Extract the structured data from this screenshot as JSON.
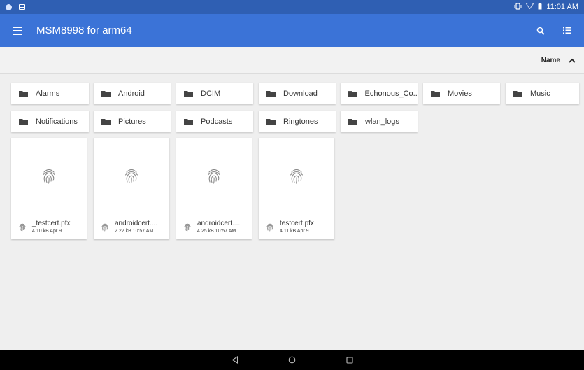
{
  "status_bar": {
    "time": "11:01 AM"
  },
  "app_bar": {
    "title": "MSM8998 for arm64"
  },
  "sort": {
    "label": "Name"
  },
  "folders": [
    {
      "name": "Alarms"
    },
    {
      "name": "Android"
    },
    {
      "name": "DCIM"
    },
    {
      "name": "Download"
    },
    {
      "name": "Echonous_Co..."
    },
    {
      "name": "Movies"
    },
    {
      "name": "Music"
    },
    {
      "name": "Notifications"
    },
    {
      "name": "Pictures"
    },
    {
      "name": "Podcasts"
    },
    {
      "name": "Ringtones"
    },
    {
      "name": "wlan_logs"
    }
  ],
  "files": [
    {
      "name": "_testcert.pfx",
      "meta": "4.10 kB Apr 9"
    },
    {
      "name": "androidcert....",
      "meta": "2.22 kB 10:57 AM"
    },
    {
      "name": "androidcert....",
      "meta": "4.25 kB 10:57 AM"
    },
    {
      "name": "testcert.pfx",
      "meta": "4.11 kB Apr 9"
    }
  ],
  "colors": {
    "status_bar": "#2f5fb3",
    "app_bar": "#3b73d7",
    "background": "#efefef"
  }
}
